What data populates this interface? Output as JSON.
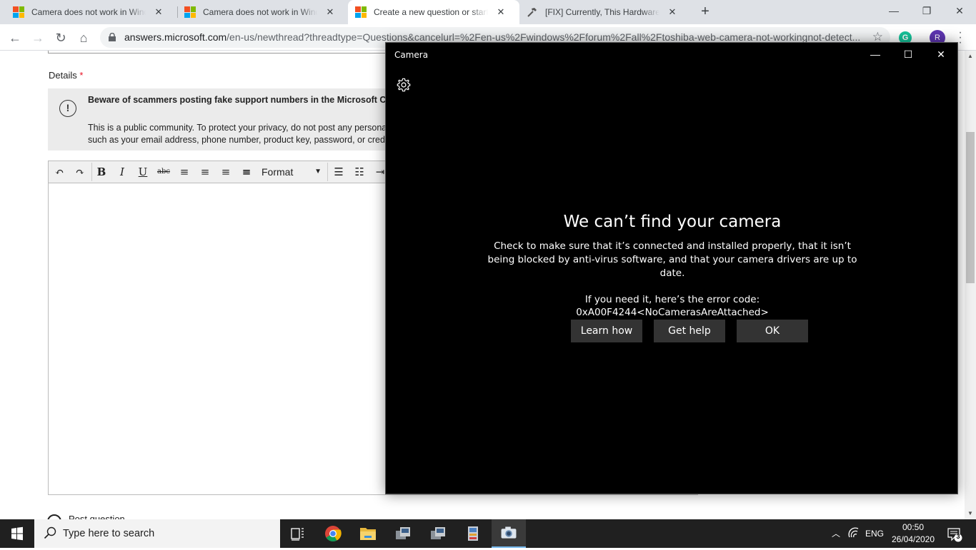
{
  "browser": {
    "tabs": [
      {
        "title": "Camera does not work in Windows",
        "favicon": "microsoft-logo",
        "active": false
      },
      {
        "title": "Camera does not work in Windows",
        "favicon": "microsoft-logo",
        "active": false
      },
      {
        "title": "Create a new question or start a discussion",
        "favicon": "microsoft-logo",
        "active": true
      },
      {
        "title": "[FIX] Currently, This Hardware Device",
        "favicon": "hammer-icon",
        "active": false
      }
    ],
    "url_host": "answers.microsoft.com",
    "url_path": "/en-us/newthread?threadtype=Questions&cancelurl=%2Fen-us%2Fwindows%2Fforum%2Fall%2Ftoshiba-web-camera-not-workingnot-detect...",
    "profile_initial": "R",
    "grammarly_initial": "G"
  },
  "page": {
    "details_label": "Details",
    "required_mark": "*",
    "warning_bold": "Beware of scammers posting fake support numbers in the Microsoft Community. If you need help.",
    "warning_text": "This is a public community. To protect your privacy, do not post any personal information such as your email address, phone number, product key, password, or credit card number.",
    "format_label": "Format",
    "radio_label": "Post question"
  },
  "camera": {
    "window_title": "Camera",
    "heading": "We can’t find your camera",
    "body": "Check to make sure that it’s connected and installed properly, that it isn’t being blocked by anti-virus software, and that your camera drivers are up to date.",
    "code_intro": "If you need it, here’s the error code:",
    "error_code": "0xA00F4244<NoCamerasAreAttached>",
    "buttons": [
      "Learn how",
      "Get help",
      "OK"
    ]
  },
  "taskbar": {
    "search_placeholder": "Type here to search",
    "language": "ENG",
    "time": "00:50",
    "date": "26/04/2020",
    "notification_count": "3"
  },
  "colors": {
    "chrome_tabstrip": "#dee1e6",
    "camera_bg": "#000000",
    "camera_button": "#333333",
    "taskbar": "#202020",
    "microsoft_red": "#f25022",
    "microsoft_green": "#7fba00",
    "microsoft_blue": "#00a4ef",
    "microsoft_yellow": "#ffb900"
  }
}
